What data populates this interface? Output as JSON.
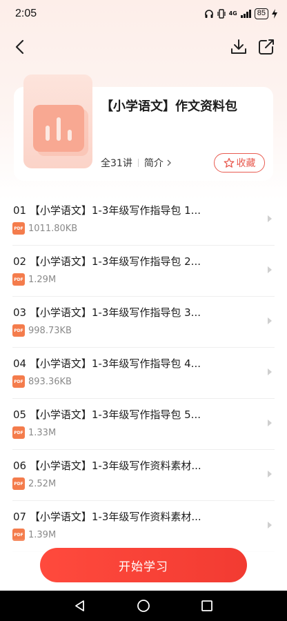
{
  "status_bar": {
    "time": "2:05",
    "network": "4G",
    "battery": "85"
  },
  "header": {
    "course_title": "【小学语文】作文资料包",
    "lesson_count": "全31讲",
    "intro_label": "简介",
    "favorite_label": "收藏"
  },
  "items": [
    {
      "index": "01",
      "title": "【小学语文】1-3年级写作指导包 1...",
      "size": "1011.80KB",
      "file_type": "PDF"
    },
    {
      "index": "02",
      "title": "【小学语文】1-3年级写作指导包 2...",
      "size": "1.29M",
      "file_type": "PDF"
    },
    {
      "index": "03",
      "title": "【小学语文】1-3年级写作指导包 3...",
      "size": "998.73KB",
      "file_type": "PDF"
    },
    {
      "index": "04",
      "title": "【小学语文】1-3年级写作指导包 4...",
      "size": "893.36KB",
      "file_type": "PDF"
    },
    {
      "index": "05",
      "title": "【小学语文】1-3年级写作指导包 5...",
      "size": "1.33M",
      "file_type": "PDF"
    },
    {
      "index": "06",
      "title": "【小学语文】1-3年级写作资料素材...",
      "size": "2.52M",
      "file_type": "PDF"
    },
    {
      "index": "07",
      "title": "【小学语文】1-3年级写作资料素材...",
      "size": "1.39M",
      "file_type": "PDF"
    }
  ],
  "footer": {
    "start_label": "开始学习"
  },
  "colors": {
    "accent": "#f23b32",
    "pdf_badge": "#f47c4c"
  }
}
